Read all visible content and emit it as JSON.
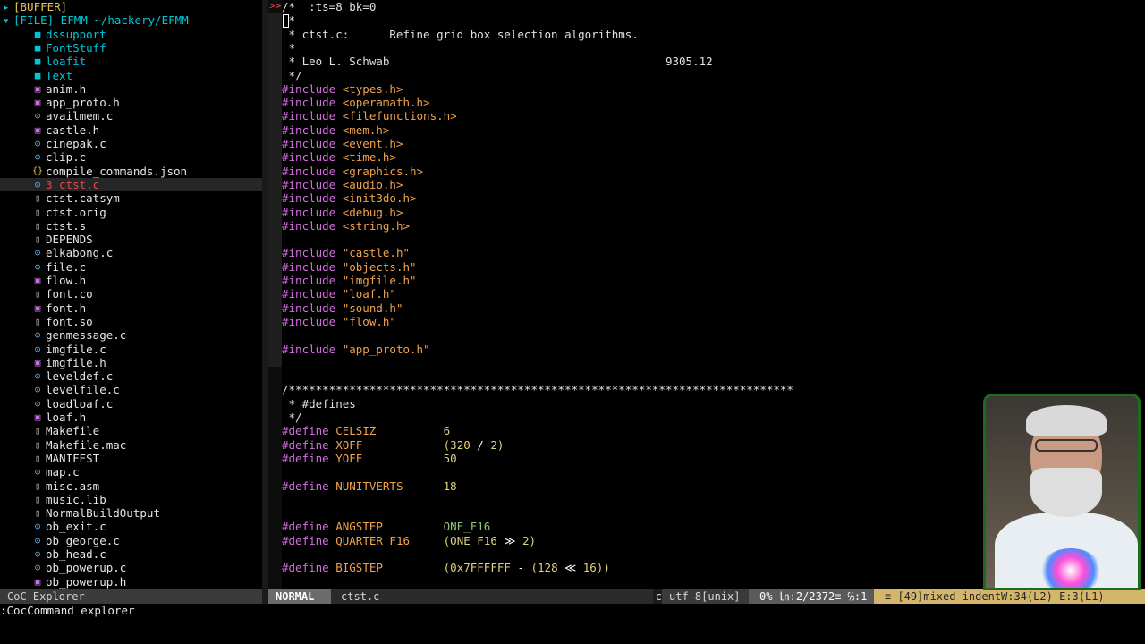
{
  "explorer": {
    "header_buffer": "[BUFFER]",
    "header_file": "[FILE] EFMM ~/hackery/EFMM",
    "items": [
      {
        "name": "dssupport",
        "type": "dir"
      },
      {
        "name": "FontStuff",
        "type": "dir"
      },
      {
        "name": "loafit",
        "type": "dir"
      },
      {
        "name": "Text",
        "type": "dir"
      },
      {
        "name": "anim.h",
        "type": "h"
      },
      {
        "name": "app_proto.h",
        "type": "h"
      },
      {
        "name": "availmem.c",
        "type": "c"
      },
      {
        "name": "castle.h",
        "type": "h"
      },
      {
        "name": "cinepak.c",
        "type": "c"
      },
      {
        "name": "clip.c",
        "type": "c"
      },
      {
        "name": "compile_commands.json",
        "type": "json"
      },
      {
        "name": "3 ctst.c",
        "type": "c",
        "selected": true
      },
      {
        "name": "ctst.catsym",
        "type": "file"
      },
      {
        "name": "ctst.orig",
        "type": "file"
      },
      {
        "name": "ctst.s",
        "type": "file"
      },
      {
        "name": "DEPENDS",
        "type": "file"
      },
      {
        "name": "elkabong.c",
        "type": "c"
      },
      {
        "name": "file.c",
        "type": "c"
      },
      {
        "name": "flow.h",
        "type": "h"
      },
      {
        "name": "font.co",
        "type": "file"
      },
      {
        "name": "font.h",
        "type": "h"
      },
      {
        "name": "font.so",
        "type": "file"
      },
      {
        "name": "genmessage.c",
        "type": "c"
      },
      {
        "name": "imgfile.c",
        "type": "c"
      },
      {
        "name": "imgfile.h",
        "type": "h"
      },
      {
        "name": "leveldef.c",
        "type": "c"
      },
      {
        "name": "levelfile.c",
        "type": "c"
      },
      {
        "name": "loadloaf.c",
        "type": "c"
      },
      {
        "name": "loaf.h",
        "type": "h"
      },
      {
        "name": "Makefile",
        "type": "file"
      },
      {
        "name": "Makefile.mac",
        "type": "file"
      },
      {
        "name": "MANIFEST",
        "type": "file"
      },
      {
        "name": "map.c",
        "type": "c"
      },
      {
        "name": "misc.asm",
        "type": "file"
      },
      {
        "name": "music.lib",
        "type": "file"
      },
      {
        "name": "NormalBuildOutput",
        "type": "file"
      },
      {
        "name": "ob_exit.c",
        "type": "c"
      },
      {
        "name": "ob_george.c",
        "type": "c"
      },
      {
        "name": "ob_head.c",
        "type": "c"
      },
      {
        "name": "ob_powerup.c",
        "type": "c"
      },
      {
        "name": "ob_powerup.h",
        "type": "h"
      }
    ]
  },
  "editor": {
    "gutter_mark": ">>",
    "lines": [
      {
        "row": 0,
        "parts": [
          [
            "cm",
            "/*  :ts=8 bk=0"
          ]
        ]
      },
      {
        "row": 1,
        "parts": [
          [
            "cm",
            " *"
          ]
        ]
      },
      {
        "row": 2,
        "parts": [
          [
            "cm",
            " * ctst.c:      Refine grid box selection algorithms."
          ]
        ]
      },
      {
        "row": 3,
        "parts": [
          [
            "cm",
            " *"
          ]
        ]
      },
      {
        "row": 4,
        "parts": [
          [
            "cm",
            " * Leo L. Schwab                                         9305.12"
          ]
        ]
      },
      {
        "row": 5,
        "parts": [
          [
            "cm",
            " */"
          ]
        ]
      },
      {
        "row": 6,
        "parts": [
          [
            "pp",
            "#include "
          ],
          [
            "inc",
            "<types.h>"
          ]
        ]
      },
      {
        "row": 7,
        "parts": [
          [
            "pp",
            "#include "
          ],
          [
            "inc",
            "<operamath.h>"
          ]
        ]
      },
      {
        "row": 8,
        "parts": [
          [
            "pp",
            "#include "
          ],
          [
            "inc",
            "<filefunctions.h>"
          ]
        ]
      },
      {
        "row": 9,
        "parts": [
          [
            "pp",
            "#include "
          ],
          [
            "inc",
            "<mem.h>"
          ]
        ]
      },
      {
        "row": 10,
        "parts": [
          [
            "pp",
            "#include "
          ],
          [
            "inc",
            "<event.h>"
          ]
        ]
      },
      {
        "row": 11,
        "parts": [
          [
            "pp",
            "#include "
          ],
          [
            "inc",
            "<time.h>"
          ]
        ]
      },
      {
        "row": 12,
        "parts": [
          [
            "pp",
            "#include "
          ],
          [
            "inc",
            "<graphics.h>"
          ]
        ]
      },
      {
        "row": 13,
        "parts": [
          [
            "pp",
            "#include "
          ],
          [
            "inc",
            "<audio.h>"
          ]
        ]
      },
      {
        "row": 14,
        "parts": [
          [
            "pp",
            "#include "
          ],
          [
            "inc",
            "<init3do.h>"
          ]
        ]
      },
      {
        "row": 15,
        "parts": [
          [
            "pp",
            "#include "
          ],
          [
            "inc",
            "<debug.h>"
          ]
        ]
      },
      {
        "row": 16,
        "parts": [
          [
            "pp",
            "#include "
          ],
          [
            "inc",
            "<string.h>"
          ]
        ]
      },
      {
        "row": 18,
        "parts": [
          [
            "pp",
            "#include "
          ],
          [
            "str",
            "\"castle.h\""
          ]
        ]
      },
      {
        "row": 19,
        "parts": [
          [
            "pp",
            "#include "
          ],
          [
            "str",
            "\"objects.h\""
          ]
        ]
      },
      {
        "row": 20,
        "parts": [
          [
            "pp",
            "#include "
          ],
          [
            "str",
            "\"imgfile.h\""
          ]
        ]
      },
      {
        "row": 21,
        "parts": [
          [
            "pp",
            "#include "
          ],
          [
            "str",
            "\"loaf.h\""
          ]
        ]
      },
      {
        "row": 22,
        "parts": [
          [
            "pp",
            "#include "
          ],
          [
            "str",
            "\"sound.h\""
          ]
        ]
      },
      {
        "row": 23,
        "parts": [
          [
            "pp",
            "#include "
          ],
          [
            "str",
            "\"flow.h\""
          ]
        ]
      },
      {
        "row": 25,
        "parts": [
          [
            "pp",
            "#include "
          ],
          [
            "str",
            "\"app_proto.h\""
          ]
        ]
      },
      {
        "row": 28,
        "parts": [
          [
            "cm",
            "/***************************************************************************"
          ]
        ]
      },
      {
        "row": 29,
        "parts": [
          [
            "cm",
            " * #defines"
          ]
        ]
      },
      {
        "row": 30,
        "parts": [
          [
            "cm",
            " */"
          ]
        ]
      },
      {
        "row": 31,
        "parts": [
          [
            "pp",
            "#define "
          ],
          [
            "ident",
            "CELSIZ"
          ],
          [
            "cm",
            "          "
          ],
          [
            "num",
            "6"
          ]
        ]
      },
      {
        "row": 32,
        "parts": [
          [
            "pp",
            "#define "
          ],
          [
            "ident",
            "XOFF"
          ],
          [
            "cm",
            "            "
          ],
          [
            "num",
            "(320 "
          ],
          [
            "op",
            "/"
          ],
          [
            "num",
            " 2)"
          ]
        ]
      },
      {
        "row": 33,
        "parts": [
          [
            "pp",
            "#define "
          ],
          [
            "ident",
            "YOFF"
          ],
          [
            "cm",
            "            "
          ],
          [
            "num",
            "50"
          ]
        ]
      },
      {
        "row": 35,
        "parts": [
          [
            "pp",
            "#define "
          ],
          [
            "ident",
            "NUNITVERTS"
          ],
          [
            "cm",
            "      "
          ],
          [
            "num",
            "18"
          ]
        ]
      },
      {
        "row": 38,
        "parts": [
          [
            "pp",
            "#define "
          ],
          [
            "ident",
            "ANGSTEP"
          ],
          [
            "cm",
            "         "
          ],
          [
            "grn",
            "ONE_F16"
          ]
        ]
      },
      {
        "row": 39,
        "parts": [
          [
            "pp",
            "#define "
          ],
          [
            "ident",
            "QUARTER_F16"
          ],
          [
            "cm",
            "     "
          ],
          [
            "num",
            "(ONE_F16 "
          ],
          [
            "op",
            "≫"
          ],
          [
            "num",
            " 2)"
          ]
        ]
      },
      {
        "row": 41,
        "parts": [
          [
            "pp",
            "#define "
          ],
          [
            "ident",
            "BIGSTEP"
          ],
          [
            "cm",
            "         "
          ],
          [
            "num",
            "(0x7FFFFFF "
          ],
          [
            "op",
            "-"
          ],
          [
            "num",
            " (128 "
          ],
          [
            "op",
            "≪"
          ],
          [
            "num",
            " 16))"
          ]
        ]
      }
    ]
  },
  "status": {
    "left": "CoC Explorer",
    "mode": "NORMAL",
    "file": "ctst.c",
    "filetype": "c",
    "encoding": "utf-8[unix]",
    "position": "0% ㏑:2/2372≡ ℅:1",
    "warning": "≡ [49]mixed-indentW:34(L2) E:3(L1)"
  },
  "cmdline": ":CocCommand explorer",
  "colors": {
    "dir": "#00c6d9",
    "h_icon": "#c76fe0",
    "c_icon": "#5fb0e0",
    "json_icon": "#e6c35c",
    "selected_text": "#e5484d"
  }
}
